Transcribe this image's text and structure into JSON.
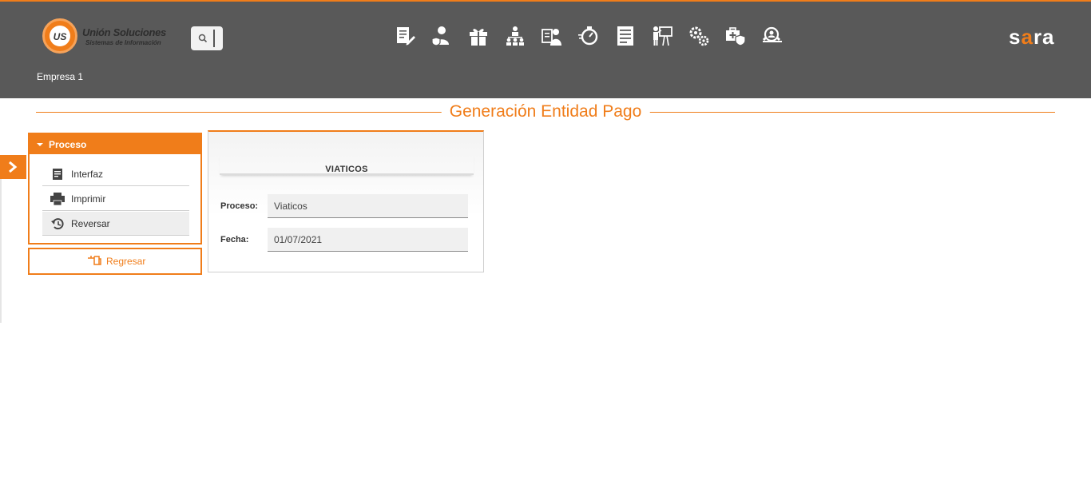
{
  "header": {
    "logo_title": "Unión Soluciones",
    "logo_subtitle": "Sistemas de Información",
    "logo_mark": "US",
    "brand": "sara",
    "company": "Empresa 1",
    "accent_color": "#f07d1a",
    "bar_color": "#595959",
    "nav_icons": [
      "document-edit-icon",
      "employee-shield-icon",
      "gift-icon",
      "org-chart-icon",
      "id-badge-icon",
      "stopwatch-icon",
      "report-list-icon",
      "presentation-icon",
      "settings-gears-icon",
      "medical-shield-icon",
      "user-search-icon"
    ]
  },
  "page": {
    "title": "Generación Entidad Pago"
  },
  "sidebar": {
    "section_label": "Proceso",
    "items": [
      {
        "label": "Interfaz",
        "icon": "note-icon"
      },
      {
        "label": "Imprimir",
        "icon": "printer-icon"
      },
      {
        "label": "Reversar",
        "icon": "undo-history-icon"
      }
    ],
    "back_label": "Regresar"
  },
  "form": {
    "title": "VIATICOS",
    "proceso_label": "Proceso:",
    "proceso_value": "Viaticos",
    "fecha_label": "Fecha:",
    "fecha_value": "01/07/2021"
  }
}
